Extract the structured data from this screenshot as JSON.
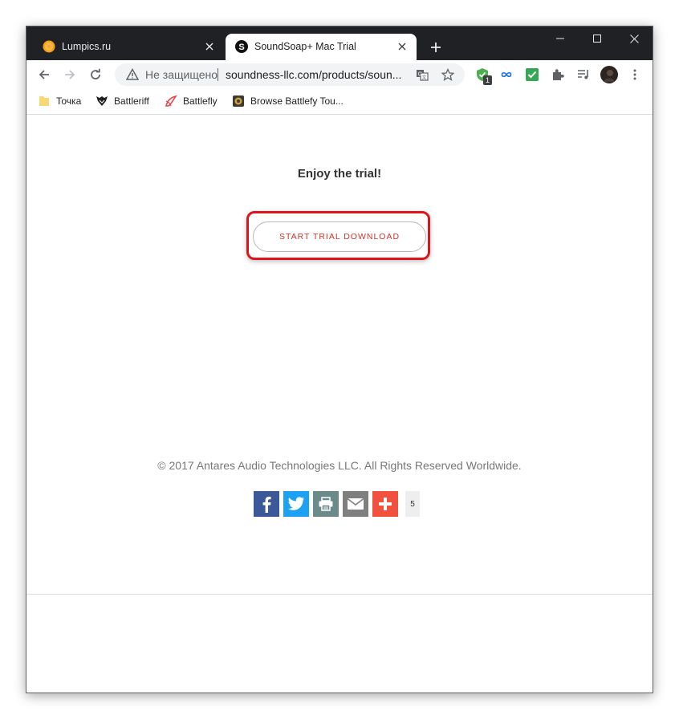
{
  "tabs": [
    {
      "title": "Lumpics.ru",
      "icon": "orange-icon",
      "active": false
    },
    {
      "title": "SoundSoap+ Mac Trial",
      "icon": "s-logo-icon",
      "active": true
    }
  ],
  "toolbar": {
    "security_label": "Не защищено",
    "url": "soundness-llc.com/products/soun...",
    "extension_badge": "1"
  },
  "bookmarks": [
    {
      "label": "Точка",
      "icon": "folder-icon"
    },
    {
      "label": "Battleriff",
      "icon": "battleriff-icon"
    },
    {
      "label": "Battlefly",
      "icon": "battlefly-icon"
    },
    {
      "label": "Browse Battlefy Tou...",
      "icon": "battlefy-icon"
    }
  ],
  "page": {
    "heading": "Enjoy the trial!",
    "cta_label": "START TRIAL DOWNLOAD",
    "copyright": "© 2017 Antares Audio Technologies LLC. All Rights Reserved Worldwide.",
    "share": {
      "buttons": [
        "facebook-icon",
        "twitter-icon",
        "print-icon",
        "email-icon",
        "add-icon"
      ],
      "count": "5"
    }
  },
  "colors": {
    "tabstrip": "#202124",
    "highlight": "#e0121a",
    "cta_text": "#d0342c",
    "facebook": "#3b5998",
    "twitter": "#1da1f2",
    "print": "#6d8a8a",
    "email": "#7f7f7f",
    "add": "#f0523e"
  }
}
